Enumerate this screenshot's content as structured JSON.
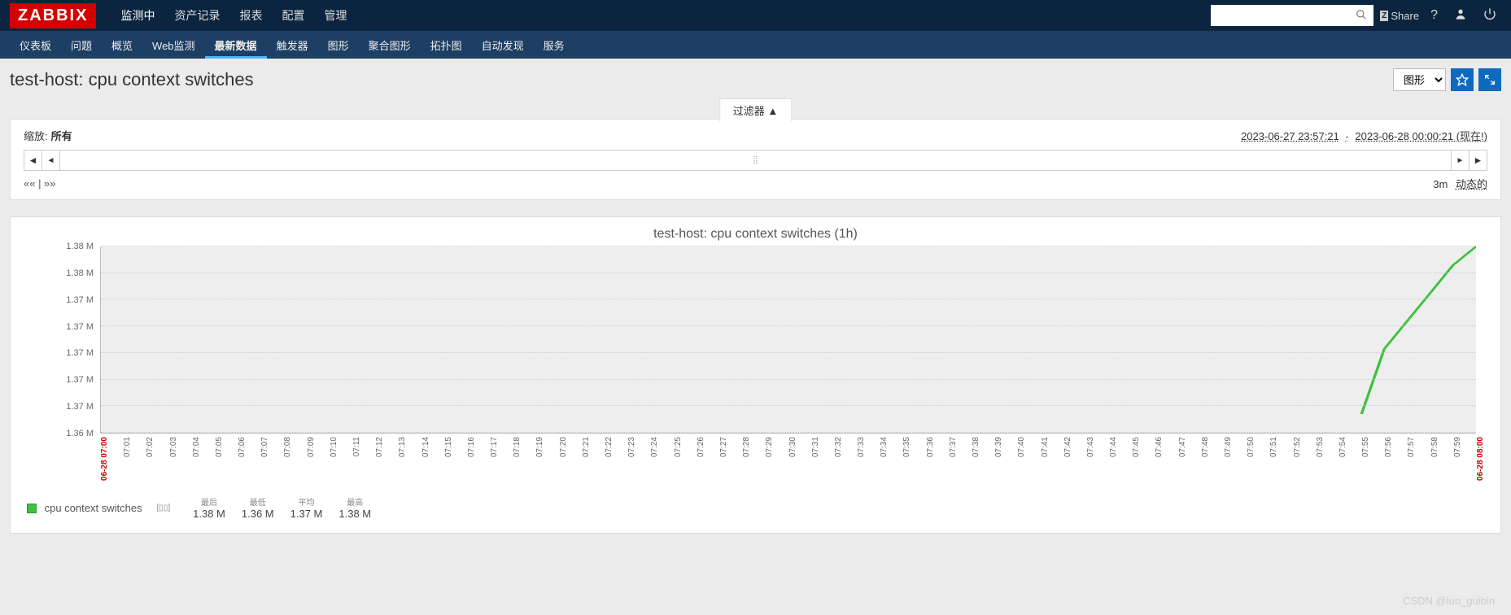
{
  "topnav": {
    "items": [
      "监测中",
      "资产记录",
      "报表",
      "配置",
      "管理"
    ],
    "activeIndex": 0
  },
  "share_label": "Share",
  "subnav": {
    "items": [
      "仪表板",
      "问题",
      "概览",
      "Web监测",
      "最新数据",
      "触发器",
      "图形",
      "聚合图形",
      "拓扑图",
      "自动发现",
      "服务"
    ],
    "activeIndex": 4
  },
  "page_title": "test-host: cpu context switches",
  "view_select": "图形",
  "filter": {
    "tab_label": "过滤器 ▲",
    "zoom_label": "缩放:",
    "zoom_value": "所有",
    "date_from": "2023-06-27 23:57:21",
    "date_to": "2023-06-28 00:00:21 (现在!)",
    "foot_left": "«« | »»",
    "foot_3m": "3m",
    "foot_dynamic": "动态的"
  },
  "legend": {
    "series_name": "cpu context switches",
    "head_labels": [
      "最后",
      "最低",
      "平均",
      "最高"
    ],
    "values": [
      "1.38 M",
      "1.36 M",
      "1.37 M",
      "1.38 M"
    ]
  },
  "watermark": "CSDN @luo_guibin",
  "chart_data": {
    "type": "line",
    "title": "test-host: cpu context switches (1h)",
    "ylabel": "",
    "ylim": [
      1360000,
      1380000
    ],
    "ytick_labels": [
      "1.36 M",
      "1.37 M",
      "1.37 M",
      "1.37 M",
      "1.37 M",
      "1.37 M",
      "1.38 M",
      "1.38 M"
    ],
    "xtick_labels": [
      "06-28 07:00",
      "07:01",
      "07:02",
      "07:03",
      "07:04",
      "07:05",
      "07:06",
      "07:07",
      "07:08",
      "07:09",
      "07:10",
      "07:11",
      "07:12",
      "07:13",
      "07:14",
      "07:15",
      "07:16",
      "07:17",
      "07:18",
      "07:19",
      "07:20",
      "07:21",
      "07:22",
      "07:23",
      "07:24",
      "07:25",
      "07:26",
      "07:27",
      "07:28",
      "07:29",
      "07:30",
      "07:31",
      "07:32",
      "07:33",
      "07:34",
      "07:35",
      "07:36",
      "07:37",
      "07:38",
      "07:39",
      "07:40",
      "07:41",
      "07:42",
      "07:43",
      "07:44",
      "07:45",
      "07:46",
      "07:47",
      "07:48",
      "07:49",
      "07:50",
      "07:51",
      "07:52",
      "07:53",
      "07:54",
      "07:55",
      "07:56",
      "07:57",
      "07:58",
      "07:59",
      "06-28 08:00"
    ],
    "xtick_red_indices": [
      0,
      60
    ],
    "series": [
      {
        "name": "cpu context switches",
        "color": "#3ec13e",
        "x_index": [
          55,
          56,
          57,
          58,
          59,
          60
        ],
        "values": [
          1362000,
          1369000,
          1372000,
          1375000,
          1378000,
          1380000
        ]
      }
    ]
  }
}
